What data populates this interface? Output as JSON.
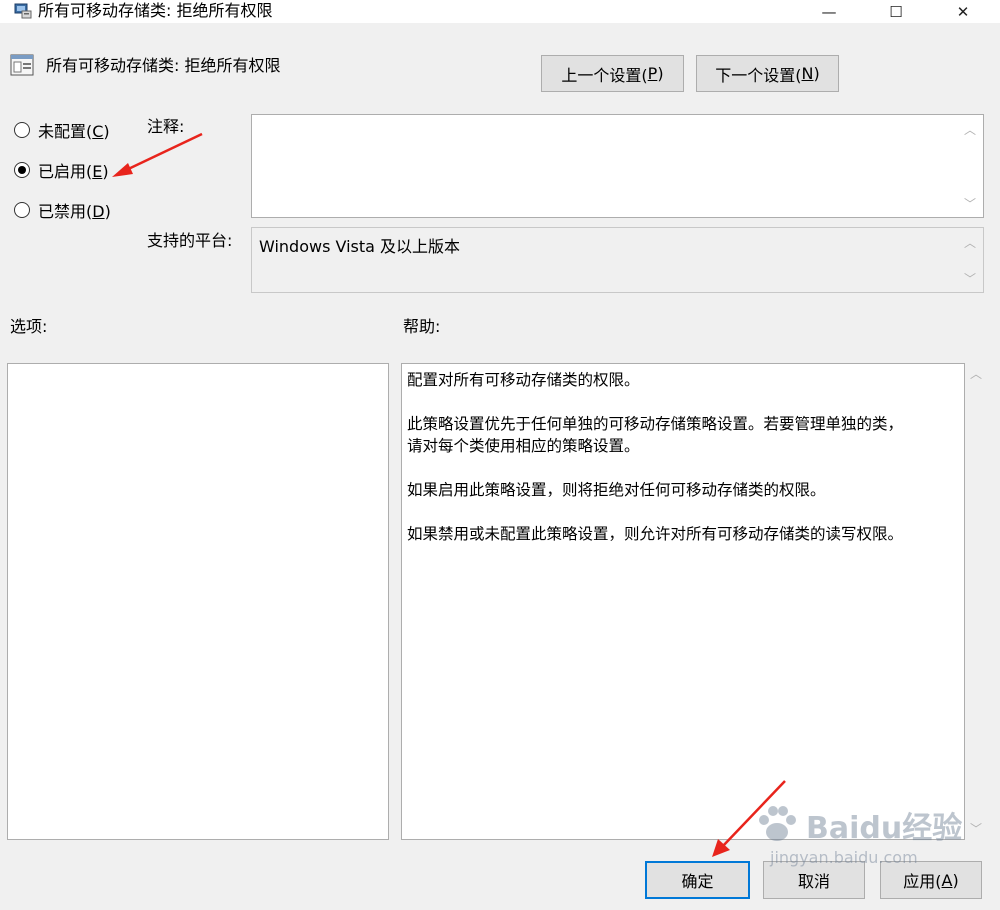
{
  "window": {
    "title": "所有可移动存储类: 拒绝所有权限",
    "minimize_glyph": "—",
    "maximize_glyph": "☐",
    "close_glyph": "✕"
  },
  "header": {
    "policy_name": "所有可移动存储类: 拒绝所有权限",
    "prev_button": {
      "text": "上一个设置(",
      "key": "P",
      "close": ")"
    },
    "next_button": {
      "text": "下一个设置(",
      "key": "N",
      "close": ")"
    }
  },
  "state": {
    "options": [
      {
        "label": "未配置(",
        "key": "C",
        "close": ")",
        "selected": false
      },
      {
        "label": "已启用(",
        "key": "E",
        "close": ")",
        "selected": true
      },
      {
        "label": "已禁用(",
        "key": "D",
        "close": ")",
        "selected": false
      }
    ]
  },
  "comment": {
    "label": "注释:",
    "value": ""
  },
  "platform": {
    "label": "支持的平台:",
    "value": "Windows Vista 及以上版本"
  },
  "options_panel": {
    "label": "选项:"
  },
  "help_panel": {
    "label": "帮助:",
    "lines": [
      "配置对所有可移动存储类的权限。",
      "",
      "此策略设置优先于任何单独的可移动存储策略设置。若要管理单独的类，",
      "请对每个类使用相应的策略设置。",
      "",
      "如果启用此策略设置，则将拒绝对任何可移动存储类的权限。",
      "",
      "如果禁用或未配置此策略设置，则允许对所有可移动存储类的读写权限。"
    ]
  },
  "footer": {
    "ok": "确定",
    "cancel": "取消",
    "apply": {
      "text": "应用(",
      "key": "A",
      "close": ")"
    }
  },
  "watermark": {
    "brand": "Baidu经验",
    "url": "jingyan.baidu.com"
  },
  "colors": {
    "annotation_arrow": "#e8241c",
    "focus_border": "#0078d7"
  }
}
